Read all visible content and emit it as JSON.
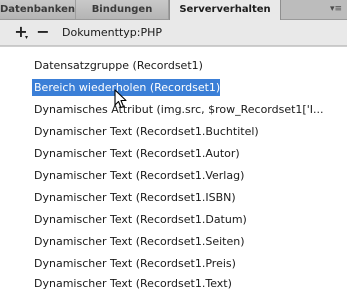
{
  "tabs": [
    {
      "label": "Datenbanken",
      "active": false
    },
    {
      "label": "Bindungen",
      "active": false
    },
    {
      "label": "Serververhalten",
      "active": true
    }
  ],
  "panel_menu_icon": "panel-options-icon",
  "toolbar": {
    "add_icon": "plus-icon",
    "remove_icon": "minus-icon",
    "doctype_label": "Dokumenttyp:PHP"
  },
  "behaviors": [
    "Datensatzgruppe (Recordset1)",
    "Bereich wiederholen (Recordset1)",
    "Dynamisches Attribut (img.src, $row_Recordset1['I...",
    "Dynamischer Text (Recordset1.Buchtitel)",
    "Dynamischer Text (Recordset1.Autor)",
    "Dynamischer Text (Recordset1.Verlag)",
    "Dynamischer Text (Recordset1.ISBN)",
    "Dynamischer Text (Recordset1.Datum)",
    "Dynamischer Text (Recordset1.Seiten)",
    "Dynamischer Text (Recordset1.Preis)",
    "Dynamischer Text (Recordset1.Text)"
  ],
  "selected_index": 1,
  "colors": {
    "selection": "#3b7fd7",
    "tabbar": "#bcbcbc",
    "active_tab": "#e9e9e9"
  }
}
